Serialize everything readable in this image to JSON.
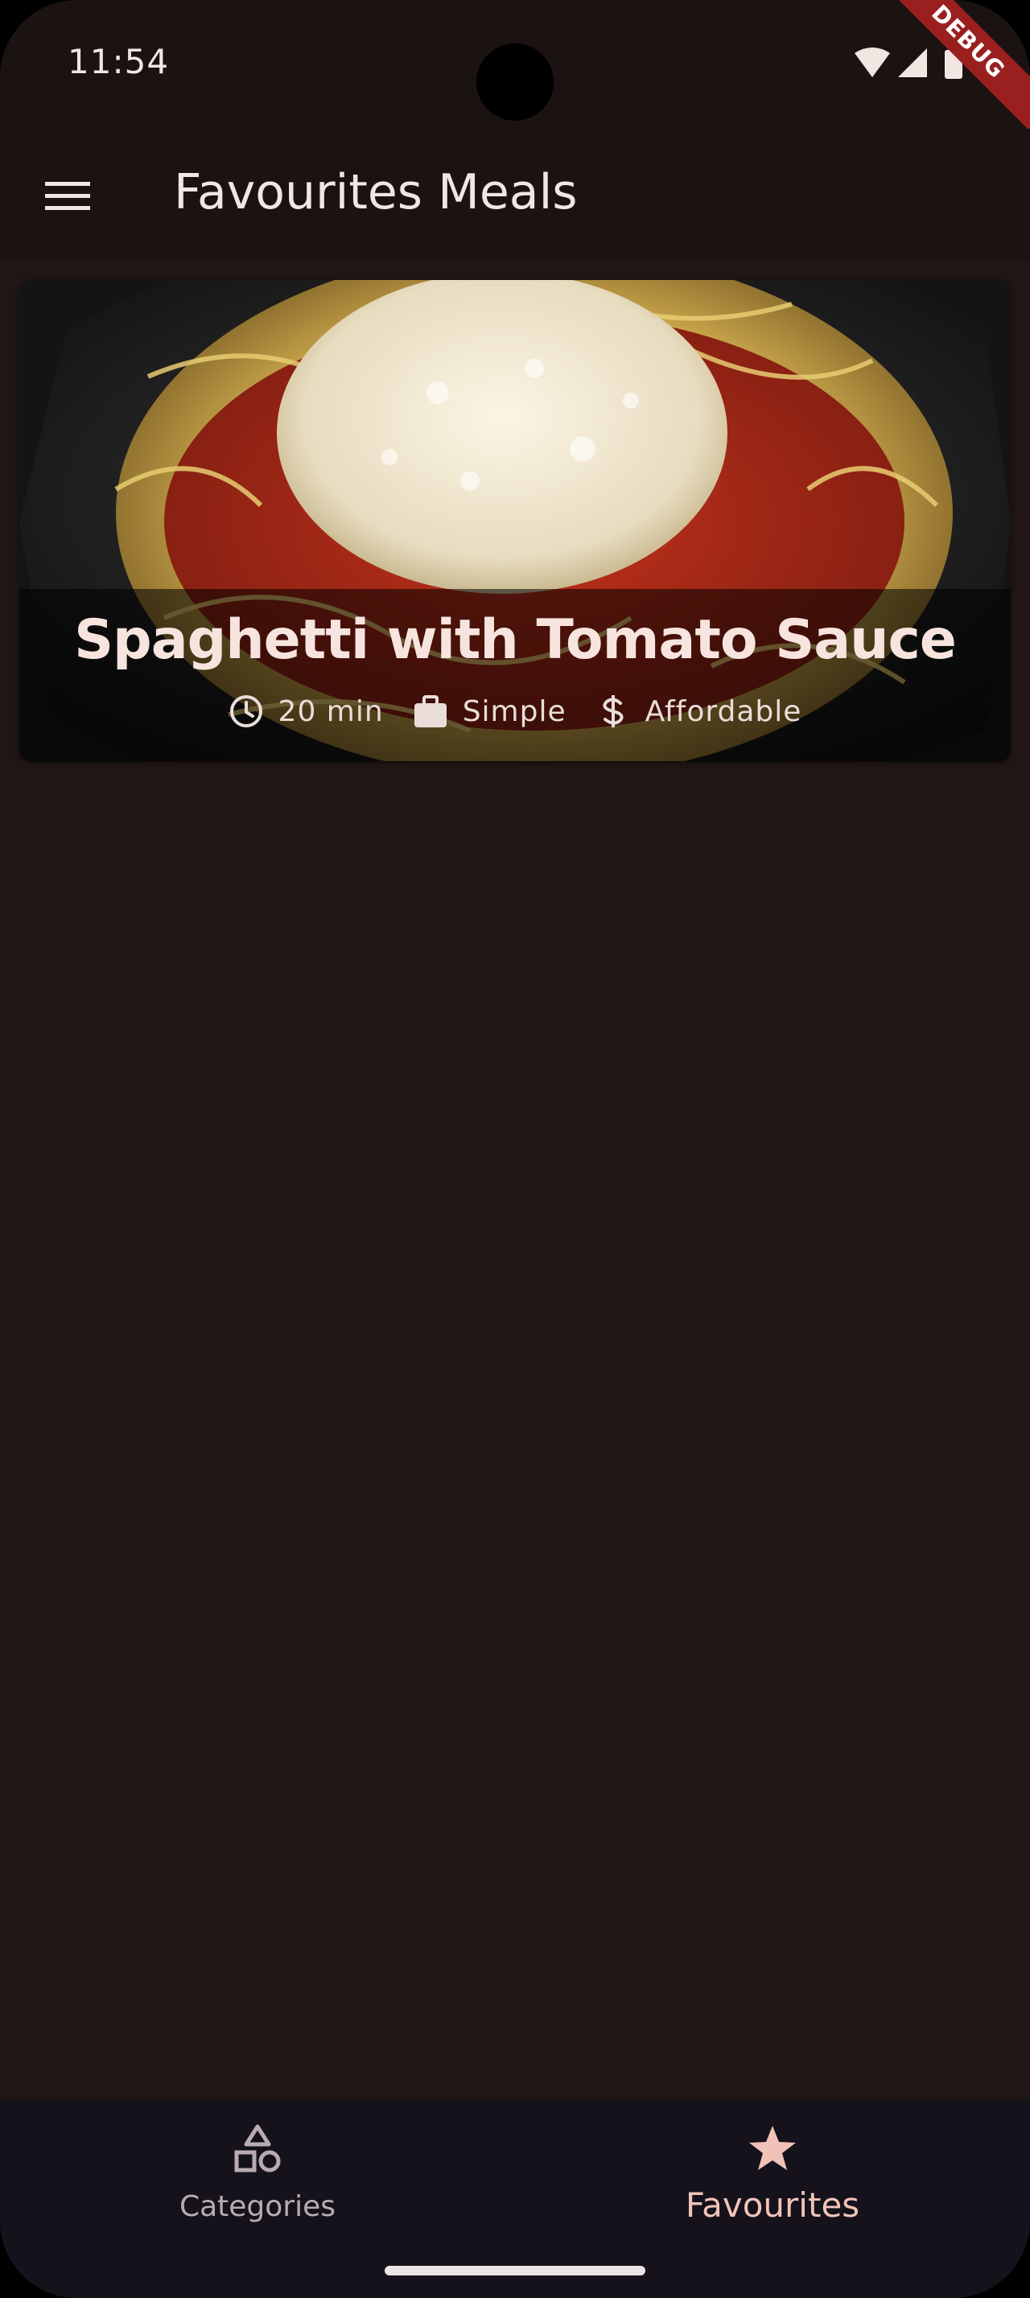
{
  "status_bar": {
    "time": "11:54",
    "debug_label": "DEBUG"
  },
  "app_bar": {
    "title": "Favourites Meals",
    "menu_icon": "menu-icon"
  },
  "meals": [
    {
      "title": "Spaghetti with Tomato Sauce",
      "duration": "20 min",
      "complexity": "Simple",
      "affordability": "Affordable",
      "duration_icon": "clock-icon",
      "complexity_icon": "briefcase-icon",
      "affordability_icon": "dollar-icon"
    }
  ],
  "bottom_nav": {
    "items": [
      {
        "label": "Categories",
        "icon": "categories-icon",
        "selected": false
      },
      {
        "label": "Favourites",
        "icon": "star-icon",
        "selected": true
      }
    ]
  },
  "colors": {
    "background": "#201614",
    "app_bar": "#1b1311",
    "nav_bar": "#15121b",
    "accent": "#f1c3b8",
    "text": "#f2e6e2"
  }
}
